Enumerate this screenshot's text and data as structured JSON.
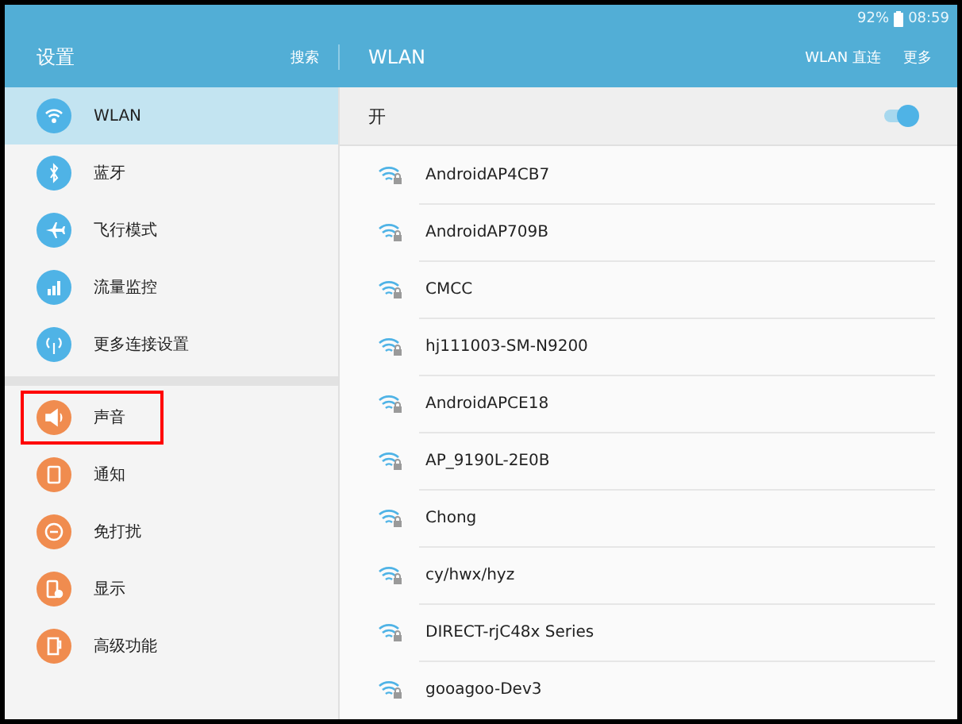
{
  "status_bar": {
    "battery": "92%",
    "time": "08:59"
  },
  "header": {
    "title": "设置",
    "search": "搜索",
    "page_title": "WLAN",
    "actions": [
      "WLAN 直连",
      "更多"
    ]
  },
  "sidebar": {
    "groups": [
      {
        "items": [
          {
            "label": "WLAN",
            "kind": "wifi",
            "color": "#4fb3e6",
            "selected": true,
            "highlighted": false
          },
          {
            "label": "蓝牙",
            "kind": "bluetooth",
            "color": "#4fb3e6",
            "selected": false,
            "highlighted": false
          },
          {
            "label": "飞行模式",
            "kind": "airplane",
            "color": "#4fb3e6",
            "selected": false,
            "highlighted": false
          },
          {
            "label": "流量监控",
            "kind": "bars",
            "color": "#4fb3e6",
            "selected": false,
            "highlighted": false
          },
          {
            "label": "更多连接设置",
            "kind": "antenna",
            "color": "#4fb3e6",
            "selected": false,
            "highlighted": false
          }
        ]
      },
      {
        "items": [
          {
            "label": "声音",
            "kind": "speaker",
            "color": "#f08c4f",
            "selected": false,
            "highlighted": true
          },
          {
            "label": "通知",
            "kind": "note",
            "color": "#f08c4f",
            "selected": false,
            "highlighted": false
          },
          {
            "label": "免打扰",
            "kind": "minus",
            "color": "#f08c4f",
            "selected": false,
            "highlighted": false
          },
          {
            "label": "显示",
            "kind": "phone",
            "color": "#f08c4f",
            "selected": false,
            "highlighted": false
          },
          {
            "label": "高级功能",
            "kind": "cup",
            "color": "#f08c4f",
            "selected": false,
            "highlighted": false
          }
        ]
      }
    ]
  },
  "wlan_switch": {
    "label": "开",
    "on": true
  },
  "networks": [
    {
      "name": "AndroidAP4CB7"
    },
    {
      "name": "AndroidAP709B"
    },
    {
      "name": "CMCC"
    },
    {
      "name": "hj111003-SM-N9200"
    },
    {
      "name": "AndroidAPCE18"
    },
    {
      "name": "AP_9190L-2E0B"
    },
    {
      "name": "Chong"
    },
    {
      "name": "cy/hwx/hyz"
    },
    {
      "name": "DIRECT-rjC48x Series"
    },
    {
      "name": "gooagoo-Dev3"
    }
  ]
}
